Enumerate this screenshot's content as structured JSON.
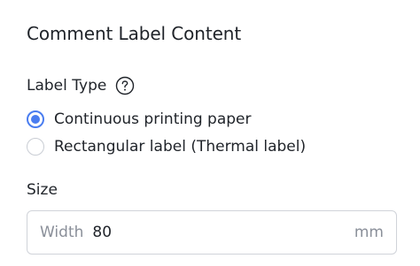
{
  "panel": {
    "title": "Comment Label Content"
  },
  "label_type": {
    "label": "Label Type",
    "help_icon": "question-circle-icon",
    "options": [
      {
        "label": "Continuous printing paper",
        "selected": true
      },
      {
        "label": "Rectangular label (Thermal label)",
        "selected": false
      }
    ]
  },
  "size": {
    "label": "Size",
    "field": {
      "prefix": "Width",
      "value": "80",
      "suffix": "mm"
    }
  },
  "colors": {
    "accent": "#4a7df0",
    "border": "#d0d3d9",
    "muted_text": "#8a8f99",
    "text": "#1f2329"
  }
}
